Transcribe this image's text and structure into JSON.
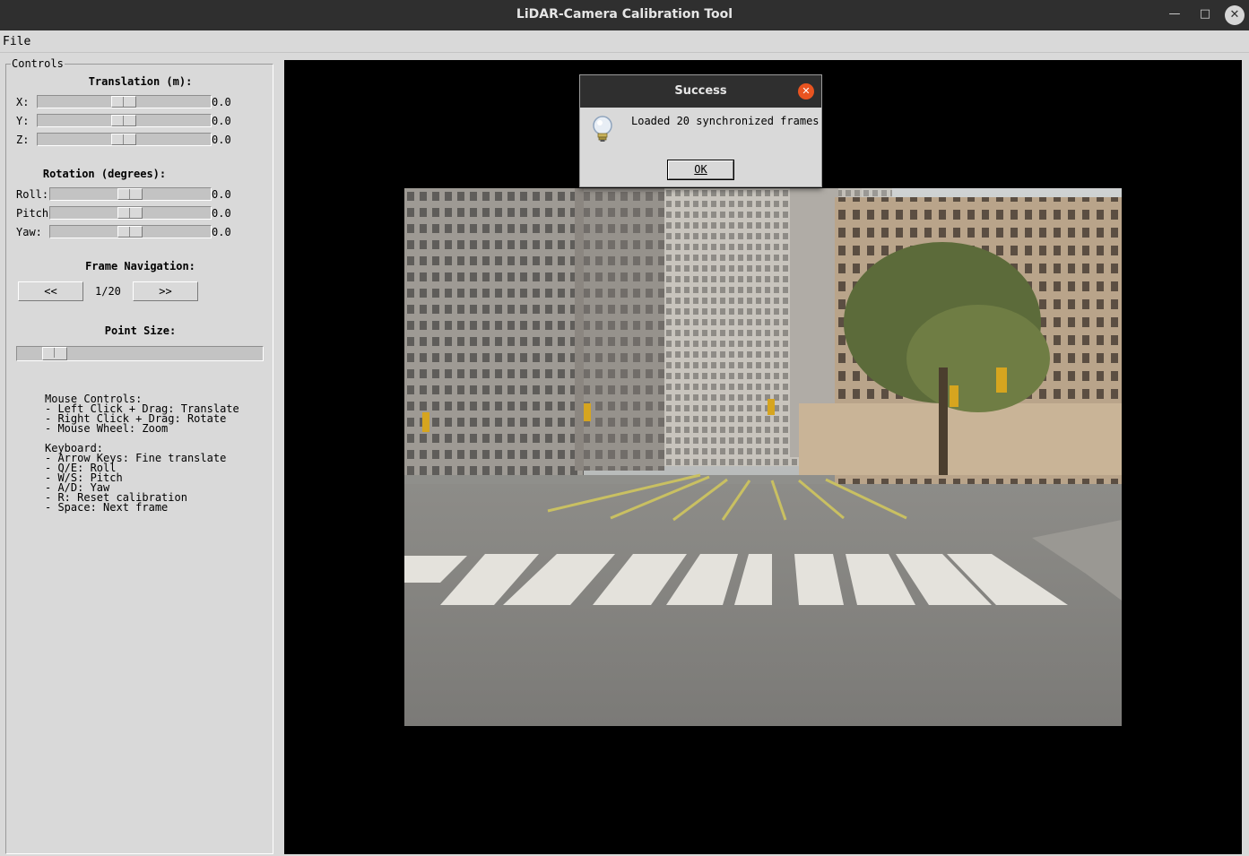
{
  "window": {
    "title": "LiDAR-Camera Calibration Tool",
    "minimize_glyph": "—",
    "maximize_glyph": "□",
    "close_glyph": "✕"
  },
  "menu": {
    "file": "File"
  },
  "controls": {
    "legend": "Controls",
    "translation": {
      "heading": "Translation (m):",
      "x_label": "X:",
      "x_value": "0.0",
      "y_label": "Y:",
      "y_value": "0.0",
      "z_label": "Z:",
      "z_value": "0.0"
    },
    "rotation": {
      "heading": "Rotation (degrees):",
      "roll_label": "Roll:",
      "roll_value": "0.0",
      "pitch_label": "Pitch",
      "pitch_value": "0.0",
      "yaw_label": "Yaw:",
      "yaw_value": "0.0"
    },
    "frame_nav": {
      "heading": "Frame Navigation:",
      "prev_label": "<<",
      "counter": "1/20",
      "next_label": ">>"
    },
    "point_size": {
      "heading": "Point Size:"
    },
    "help": {
      "mouse": "Mouse Controls:\n- Left Click + Drag: Translate\n- Right Click + Drag: Rotate\n- Mouse Wheel: Zoom",
      "keyboard": "Keyboard:\n- Arrow Keys: Fine translate\n- Q/E: Roll\n- W/S: Pitch\n- A/D: Yaw\n- R: Reset calibration\n- Space: Next frame"
    }
  },
  "dialog": {
    "title": "Success",
    "message": "Loaded 20 synchronized frames",
    "ok_label": "OK",
    "icon": "lightbulb-icon"
  },
  "colors": {
    "titlebar": "#2f2f2f",
    "panel": "#d9d9d9",
    "canvas": "#000000",
    "dialog_close": "#e95420"
  }
}
